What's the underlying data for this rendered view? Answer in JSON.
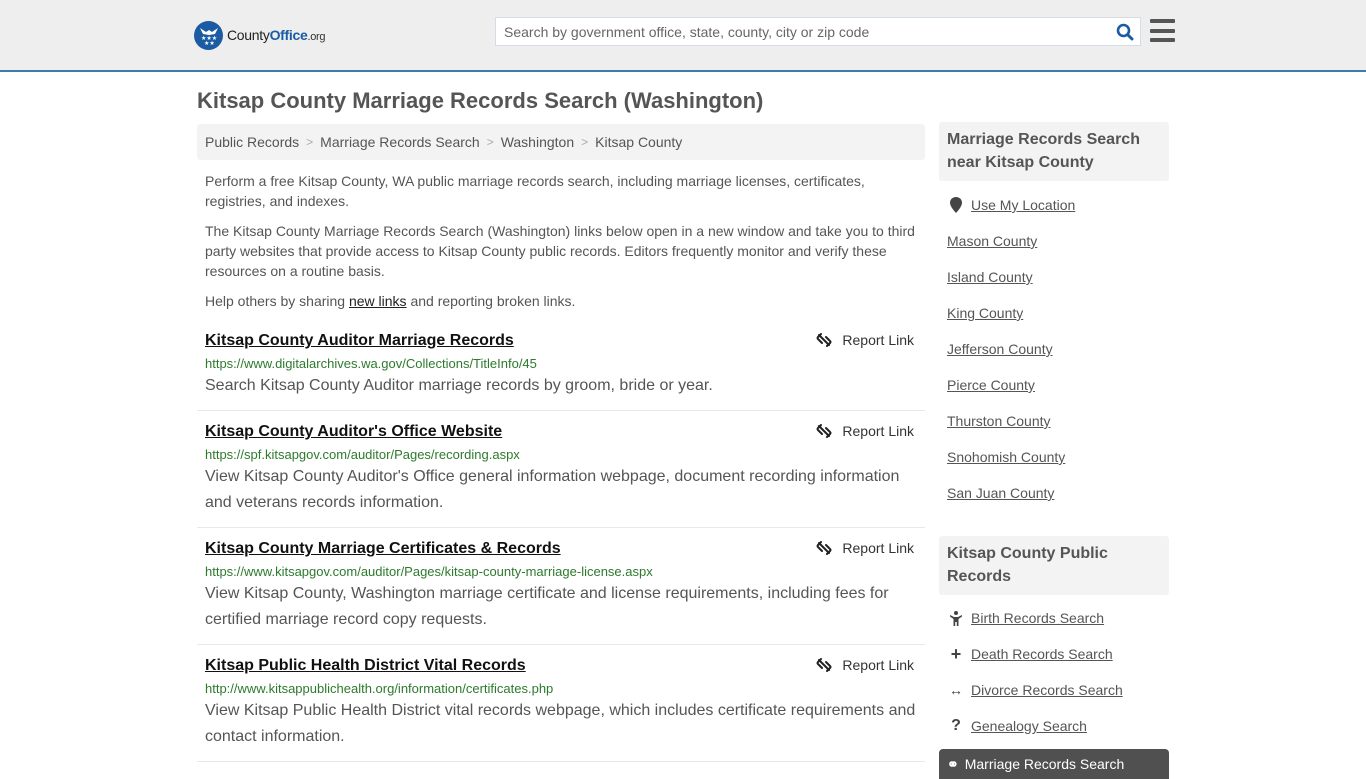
{
  "header": {
    "logo": {
      "name_plain": "County",
      "name_brand": "Office",
      "tld": ".org"
    },
    "search": {
      "placeholder": "Search by government office, state, county, city or zip code",
      "value": ""
    },
    "colors": {
      "accent": "#3a7cb0",
      "brand": "#1b5ba3"
    }
  },
  "page": {
    "title": "Kitsap County Marriage Records Search (Washington)",
    "breadcrumb": [
      "Public Records",
      "Marriage Records Search",
      "Washington",
      "Kitsap County"
    ],
    "intro": {
      "p1": "Perform a free Kitsap County, WA public marriage records search, including marriage licenses, certificates, registries, and indexes.",
      "p2": "The Kitsap County Marriage Records Search (Washington) links below open in a new window and take you to third party websites that provide access to Kitsap County public records. Editors frequently monitor and verify these resources on a routine basis.",
      "p3_before": "Help others by sharing ",
      "p3_link": "new links",
      "p3_after": " and reporting broken links."
    }
  },
  "results": [
    {
      "title": "Kitsap County Auditor Marriage Records",
      "url": "https://www.digitalarchives.wa.gov/Collections/TitleInfo/45",
      "description": "Search Kitsap County Auditor marriage records by groom, bride or year.",
      "report_label": "Report Link"
    },
    {
      "title": "Kitsap County Auditor's Office Website",
      "url": "https://spf.kitsapgov.com/auditor/Pages/recording.aspx",
      "description": "View Kitsap County Auditor's Office general information webpage, document recording information and veterans records information.",
      "report_label": "Report Link"
    },
    {
      "title": "Kitsap County Marriage Certificates & Records",
      "url": "https://www.kitsapgov.com/auditor/Pages/kitsap-county-marriage-license.aspx",
      "description": "View Kitsap County, Washington marriage certificate and license requirements, including fees for certified marriage record copy requests.",
      "report_label": "Report Link"
    },
    {
      "title": "Kitsap Public Health District Vital Records",
      "url": "http://www.kitsappublichealth.org/information/certificates.php",
      "description": "View Kitsap Public Health District vital records webpage, which includes certificate requirements and contact information.",
      "report_label": "Report Link"
    }
  ],
  "sidebar": {
    "nearby": {
      "heading": "Marriage Records Search near Kitsap County",
      "use_location": "Use My Location",
      "counties": [
        "Mason County",
        "Island County",
        "King County",
        "Jefferson County",
        "Pierce County",
        "Thurston County",
        "Snohomish County",
        "San Juan County"
      ]
    },
    "public_records": {
      "heading": "Kitsap County Public Records",
      "items": [
        {
          "label": "Birth Records Search",
          "icon": "child-icon"
        },
        {
          "label": "Death Records Search",
          "icon": "plus-icon"
        },
        {
          "label": "Divorce Records Search",
          "icon": "arrows-horizontal-icon"
        },
        {
          "label": "Genealogy Search",
          "icon": "question-icon"
        }
      ],
      "active": {
        "label": "Marriage Records Search",
        "icon": "marriage-icon"
      }
    }
  }
}
